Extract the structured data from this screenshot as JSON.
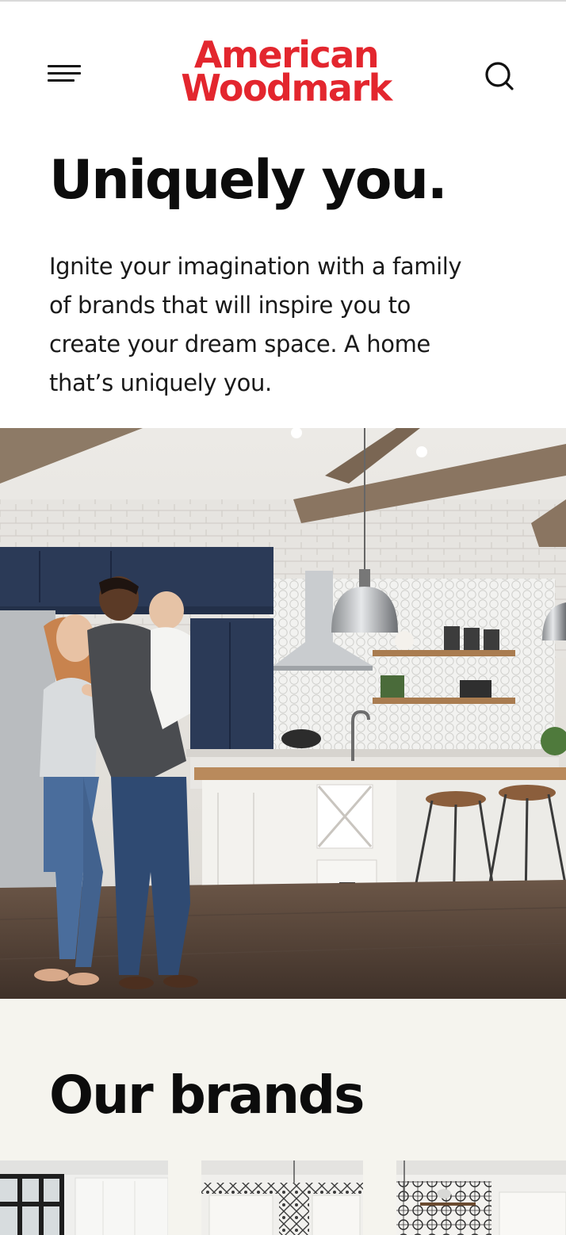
{
  "header": {
    "logo_line1": "American",
    "logo_line2": "Woodmark",
    "menu_icon": "hamburger-menu-icon",
    "search_icon": "search-icon"
  },
  "hero": {
    "title": "Uniquely you.",
    "body": "Ignite your imagination with a family of brands that will inspire you to create your dream space. A home that’s uniquely you.",
    "image": "kitchen-family-photo"
  },
  "brands": {
    "title": "Our brands",
    "cards": [
      "brand-card-image",
      "brand-card-image",
      "brand-card-image"
    ]
  },
  "colors": {
    "brand_red": "#e3262e",
    "text": "#0c0c0c",
    "brands_bg": "#f5f4ee"
  }
}
